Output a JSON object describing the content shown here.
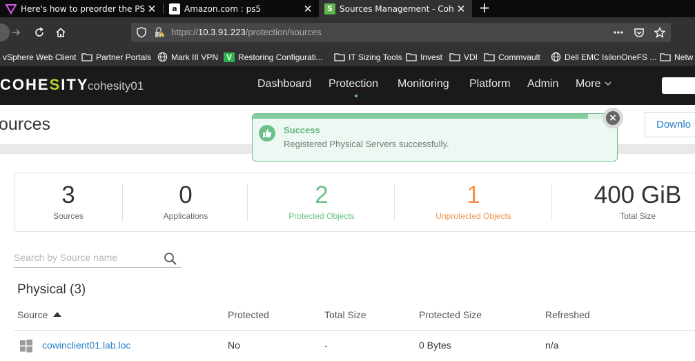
{
  "browser": {
    "tabs": [
      {
        "title": "Here's how to preorder the PS5",
        "favicon": "vivaldi-v-icon",
        "close": "✕"
      },
      {
        "title": "Amazon.com : ps5",
        "favicon": "amazon-a-icon",
        "close": "✕"
      },
      {
        "title": "Sources Management - Cohesity",
        "favicon": "cohesity-s-icon",
        "close": "✕"
      }
    ],
    "new_tab": "+",
    "url": {
      "scheme": "https://",
      "host": "10.3.91.223",
      "path": "/protection/sources"
    },
    "bookmarks": [
      {
        "label": "vSphere Web Client",
        "icon": "none"
      },
      {
        "label": "Partner Portals",
        "icon": "folder-icon"
      },
      {
        "label": "Mark III VPN",
        "icon": "globe-icon"
      },
      {
        "label": "Restoring Configurati...",
        "icon": "veeam-v-icon"
      },
      {
        "label": "IT Sizing Tools",
        "icon": "folder-icon"
      },
      {
        "label": "Invest",
        "icon": "folder-icon"
      },
      {
        "label": "VDI",
        "icon": "folder-icon"
      },
      {
        "label": "Commvault",
        "icon": "folder-icon"
      },
      {
        "label": "Dell EMC IsilonOneFS ...",
        "icon": "globe-icon"
      },
      {
        "label": "Netw",
        "icon": "folder-icon"
      }
    ]
  },
  "app": {
    "logo_prefix": "COHE",
    "logo_s": "S",
    "logo_suffix": "ITY",
    "cluster": "cohesity01",
    "nav": [
      "Dashboard",
      "Protection",
      "Monitoring",
      "Platform",
      "Admin",
      "More"
    ],
    "active_nav": "Protection"
  },
  "page": {
    "title": "ources",
    "download_label": "Downlo"
  },
  "toast": {
    "title": "Success",
    "message": "Registered Physical Servers successfully.",
    "close": "×"
  },
  "stats": [
    {
      "value": "3",
      "label": "Sources",
      "tone": "default"
    },
    {
      "value": "0",
      "label": "Applications",
      "tone": "default"
    },
    {
      "value": "2",
      "label": "Protected Objects",
      "tone": "green"
    },
    {
      "value": "1",
      "label": "Unprotected Objects",
      "tone": "orange"
    },
    {
      "value": "400 GiB",
      "label": "Total Size",
      "tone": "default"
    }
  ],
  "search": {
    "placeholder": "Search by Source name"
  },
  "section": {
    "title": "Physical (3)"
  },
  "table": {
    "columns": [
      "Source",
      "Protected",
      "Total Size",
      "Protected Size",
      "Refreshed"
    ],
    "rows": [
      {
        "source": "cowinclient01.lab.loc",
        "protected": "No",
        "total_size": "-",
        "protected_size": "0 Bytes",
        "refreshed": "n/a"
      }
    ]
  },
  "colors": {
    "accent_green": "#6cc18b",
    "accent_orange": "#f1934b",
    "link_blue": "#2a7fc7",
    "logo_s_lime": "#b5d334"
  }
}
